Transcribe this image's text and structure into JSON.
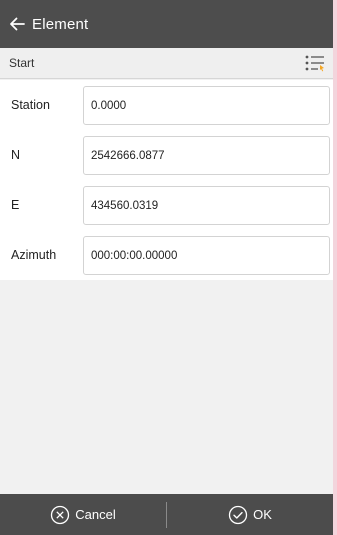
{
  "header": {
    "title": "Element",
    "back_icon": "arrow-left-icon"
  },
  "subheader": {
    "label": "Start",
    "list_icon": "list-settings-icon",
    "accent": "#f5a623"
  },
  "form": {
    "rows": [
      {
        "label": "Station",
        "value": "0.0000"
      },
      {
        "label": "N",
        "value": "2542666.0877"
      },
      {
        "label": "E",
        "value": "434560.0319"
      },
      {
        "label": "Azimuth",
        "value": "000:00:00.00000"
      }
    ]
  },
  "footer": {
    "cancel_label": "Cancel",
    "cancel_icon": "circle-x-icon",
    "ok_label": "OK",
    "ok_icon": "circle-check-icon"
  }
}
